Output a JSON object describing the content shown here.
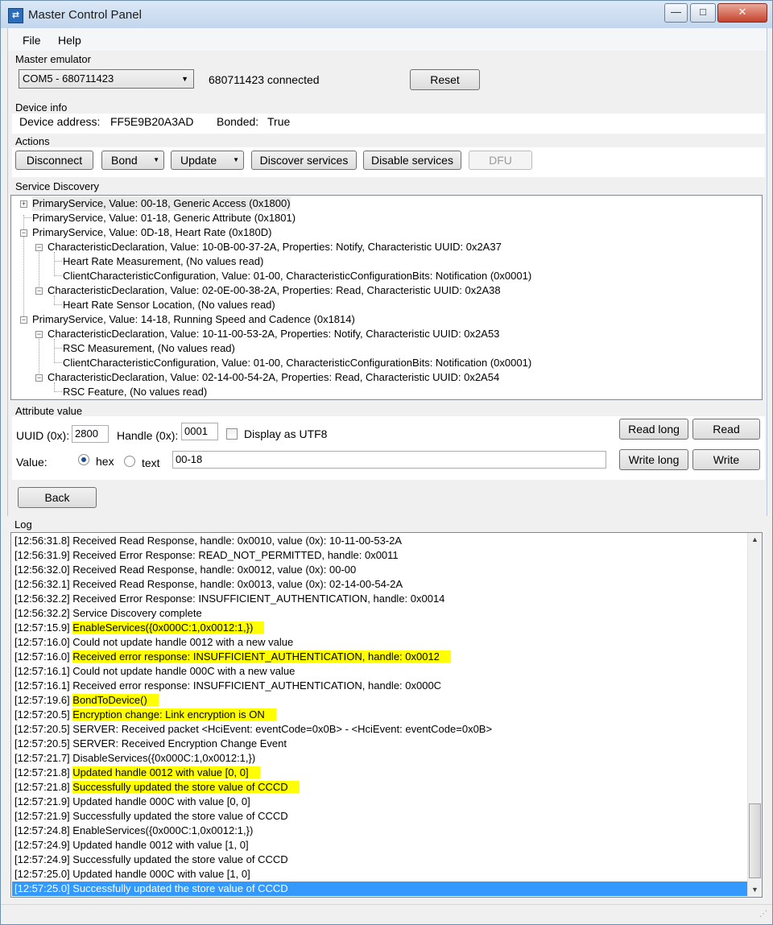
{
  "window": {
    "title": "Master Control Panel",
    "min_glyph": "—",
    "max_glyph": "□",
    "close_glyph": "✕"
  },
  "menu": {
    "file": "File",
    "help": "Help"
  },
  "master_emulator": {
    "section_title": "Master emulator",
    "port": "COM5 - 680711423",
    "status": "680711423 connected",
    "reset_label": "Reset"
  },
  "device_info": {
    "section_title": "Device info",
    "address_label": "Device address:",
    "address_value": "FF5E9B20A3AD",
    "bonded_label": "Bonded:",
    "bonded_value": "True"
  },
  "actions": {
    "section_title": "Actions",
    "disconnect": "Disconnect",
    "bond": "Bond",
    "update": "Update",
    "discover": "Discover services",
    "disable": "Disable services",
    "dfu": "DFU"
  },
  "service_discovery": {
    "section_title": "Service Discovery",
    "nodes": [
      "PrimaryService, Value: 00-18, Generic Access (0x1800)",
      "PrimaryService, Value: 01-18, Generic Attribute (0x1801)",
      "PrimaryService, Value: 0D-18, Heart Rate (0x180D)",
      "CharacteristicDeclaration, Value: 10-0B-00-37-2A, Properties: Notify, Characteristic UUID: 0x2A37",
      "Heart Rate Measurement, (No values read)",
      "ClientCharacteristicConfiguration, Value: 01-00, CharacteristicConfigurationBits: Notification (0x0001)",
      "CharacteristicDeclaration, Value: 02-0E-00-38-2A, Properties: Read, Characteristic UUID: 0x2A38",
      "Heart Rate Sensor Location, (No values read)",
      "PrimaryService, Value: 14-18, Running Speed and Cadence (0x1814)",
      "CharacteristicDeclaration, Value: 10-11-00-53-2A, Properties: Notify, Characteristic UUID: 0x2A53",
      "RSC Measurement, (No values read)",
      "ClientCharacteristicConfiguration, Value: 01-00, CharacteristicConfigurationBits: Notification (0x0001)",
      "CharacteristicDeclaration, Value: 02-14-00-54-2A, Properties: Read, Characteristic UUID: 0x2A54",
      "RSC Feature, (No values read)"
    ]
  },
  "attribute_value": {
    "section_title": "Attribute value",
    "uuid_label": "UUID (0x):",
    "uuid_value": "2800",
    "handle_label": "Handle (0x):",
    "handle_value": "0001",
    "utf8_label": "Display as UTF8",
    "utf8_checked": false,
    "value_label": "Value:",
    "hex_label": "hex",
    "text_label": "text",
    "format_selected": "hex",
    "value": "00-18",
    "read_long": "Read long",
    "read": "Read",
    "write_long": "Write long",
    "write": "Write"
  },
  "back_label": "Back",
  "log": {
    "section_title": "Log",
    "entries": [
      {
        "ts": "[12:56:31.8]",
        "msg": "Received Read Response, handle: 0x0010, value (0x): 10-11-00-53-2A",
        "highlight": false
      },
      {
        "ts": "[12:56:31.9]",
        "msg": "Received Error Response: READ_NOT_PERMITTED, handle: 0x0011",
        "highlight": false
      },
      {
        "ts": "[12:56:32.0]",
        "msg": "Received Read Response, handle: 0x0012, value (0x): 00-00",
        "highlight": false
      },
      {
        "ts": "[12:56:32.1]",
        "msg": "Received Read Response, handle: 0x0013, value (0x): 02-14-00-54-2A",
        "highlight": false
      },
      {
        "ts": "[12:56:32.2]",
        "msg": "Received Error Response: INSUFFICIENT_AUTHENTICATION, handle: 0x0014",
        "highlight": false
      },
      {
        "ts": "[12:56:32.2]",
        "msg": "Service Discovery complete",
        "highlight": false
      },
      {
        "ts": "[12:57:15.9]",
        "msg": "EnableServices({0x000C:1,0x0012:1,})",
        "highlight": true
      },
      {
        "ts": "[12:57:16.0]",
        "msg": "Could not update handle 0012 with a new value",
        "highlight": false
      },
      {
        "ts": "[12:57:16.0]",
        "msg": "Received error response: INSUFFICIENT_AUTHENTICATION, handle: 0x0012",
        "highlight": true
      },
      {
        "ts": "[12:57:16.1]",
        "msg": "Could not update handle 000C with a new value",
        "highlight": false
      },
      {
        "ts": "[12:57:16.1]",
        "msg": "Received error response: INSUFFICIENT_AUTHENTICATION, handle: 0x000C",
        "highlight": false
      },
      {
        "ts": "[12:57:19.6]",
        "msg": "BondToDevice()",
        "highlight": true
      },
      {
        "ts": "[12:57:20.5]",
        "msg": "Encryption change: Link encryption is ON",
        "highlight": true
      },
      {
        "ts": "[12:57:20.5]",
        "msg": "SERVER: Received packet <HciEvent: eventCode=0x0B> - <HciEvent: eventCode=0x0B>",
        "highlight": false
      },
      {
        "ts": "[12:57:20.5]",
        "msg": "SERVER: Received Encryption Change Event",
        "highlight": false
      },
      {
        "ts": "[12:57:21.7]",
        "msg": "DisableServices({0x000C:1,0x0012:1,})",
        "highlight": false
      },
      {
        "ts": "[12:57:21.8]",
        "msg": "Updated handle 0012 with value [0, 0]",
        "highlight": true
      },
      {
        "ts": "[12:57:21.8]",
        "msg": "Successfully updated the store value of CCCD",
        "highlight": true
      },
      {
        "ts": "[12:57:21.9]",
        "msg": "Updated handle 000C with value [0, 0]",
        "highlight": false
      },
      {
        "ts": "[12:57:21.9]",
        "msg": "Successfully updated the store value of CCCD",
        "highlight": false
      },
      {
        "ts": "[12:57:24.8]",
        "msg": "EnableServices({0x000C:1,0x0012:1,})",
        "highlight": false
      },
      {
        "ts": "[12:57:24.9]",
        "msg": "Updated handle 0012 with value [1, 0]",
        "highlight": false
      },
      {
        "ts": "[12:57:24.9]",
        "msg": "Successfully updated the store value of CCCD",
        "highlight": false
      },
      {
        "ts": "[12:57:25.0]",
        "msg": "Updated handle 000C with value [1, 0]",
        "highlight": false
      },
      {
        "ts": "[12:57:25.0]",
        "msg": "Successfully updated the store value of CCCD",
        "highlight": false,
        "selected": true
      }
    ]
  },
  "colors": {
    "highlight": "#ffff00",
    "selection": "#3399ff"
  }
}
